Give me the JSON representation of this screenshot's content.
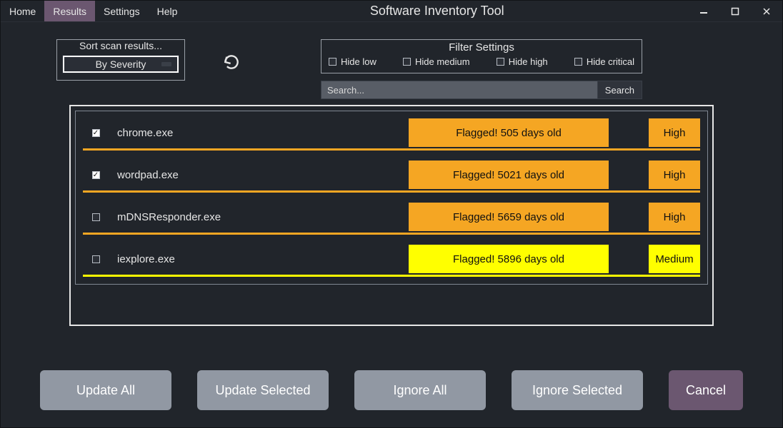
{
  "window": {
    "title": "Software Inventory Tool",
    "menu": [
      {
        "label": "Home",
        "active": false
      },
      {
        "label": "Results",
        "active": true
      },
      {
        "label": "Settings",
        "active": false
      },
      {
        "label": "Help",
        "active": false
      }
    ]
  },
  "sort": {
    "title": "Sort scan results...",
    "selected": "By Severity"
  },
  "filters": {
    "title": "Filter Settings",
    "items": [
      {
        "label": "Hide low",
        "checked": false
      },
      {
        "label": "Hide medium",
        "checked": false
      },
      {
        "label": "Hide high",
        "checked": false
      },
      {
        "label": "Hide critical",
        "checked": false
      }
    ]
  },
  "search": {
    "placeholder": "Search...",
    "value": "",
    "button": "Search"
  },
  "results": [
    {
      "checked": true,
      "name": "chrome.exe",
      "flag": "Flagged! 505 days old",
      "severity": "High"
    },
    {
      "checked": true,
      "name": "wordpad.exe",
      "flag": "Flagged! 5021 days old",
      "severity": "High"
    },
    {
      "checked": false,
      "name": "mDNSResponder.exe",
      "flag": "Flagged! 5659 days old",
      "severity": "High"
    },
    {
      "checked": false,
      "name": "iexplore.exe",
      "flag": "Flagged! 5896 days old",
      "severity": "Medium"
    }
  ],
  "buttons": {
    "update_all": "Update All",
    "update_selected": "Update Selected",
    "ignore_all": "Ignore All",
    "ignore_selected": "Ignore Selected",
    "cancel": "Cancel"
  }
}
